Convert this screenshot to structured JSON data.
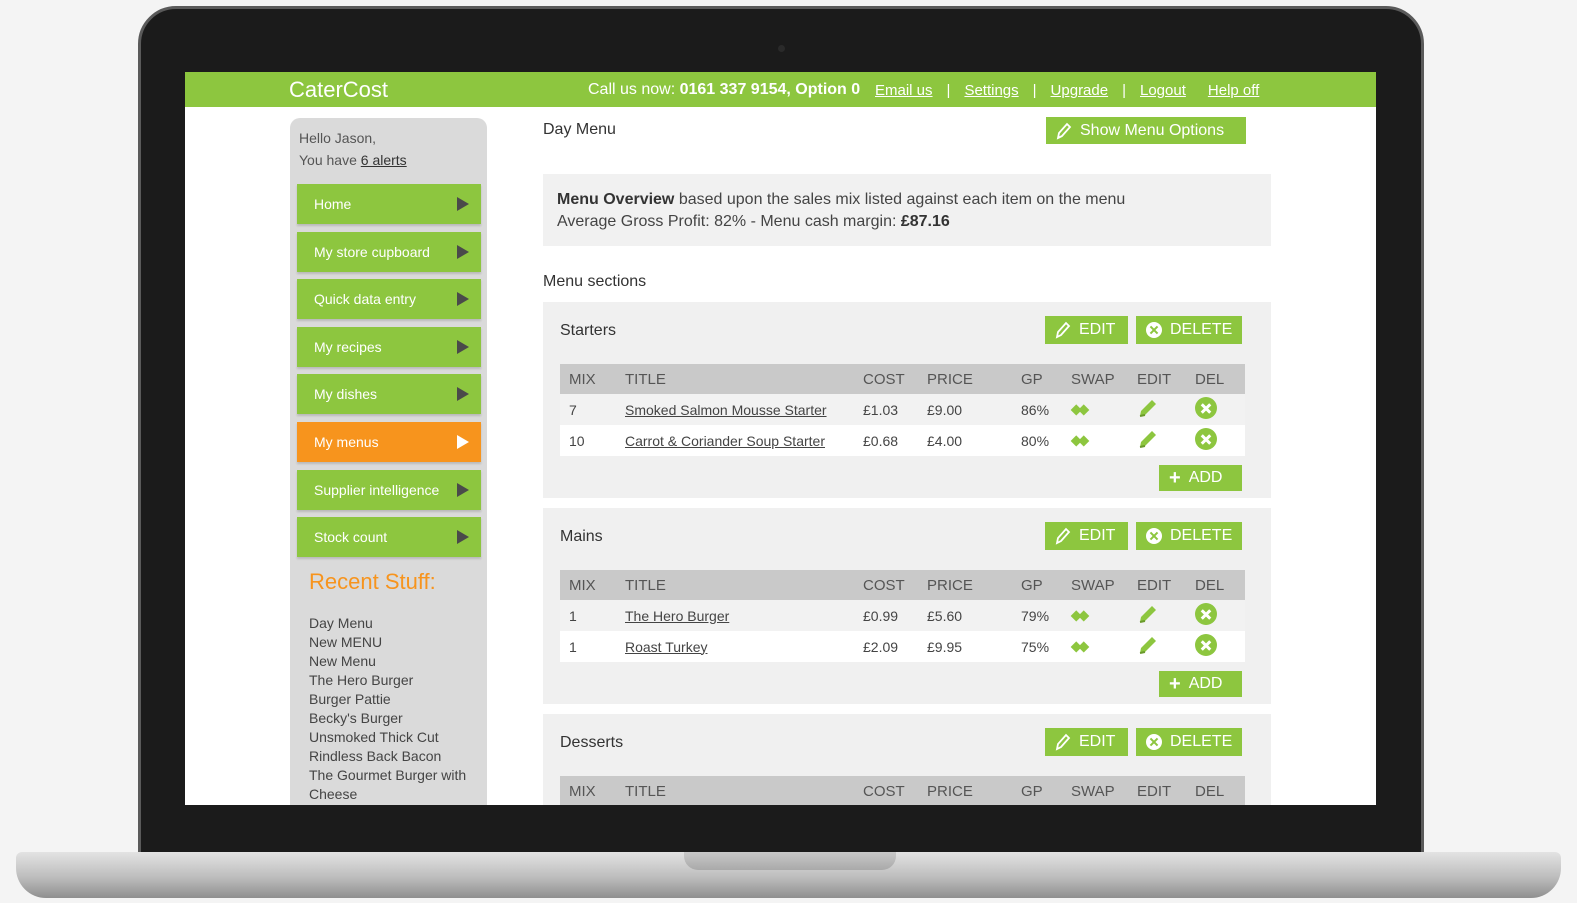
{
  "header": {
    "logo": "CaterCost",
    "call_prefix": "Call us now:",
    "phone": "0161 337 9154, Option 0",
    "links": [
      "Email us",
      "Settings",
      "Upgrade",
      "Logout",
      "Help off"
    ]
  },
  "sidebar": {
    "hello": "Hello Jason,",
    "alerts_prefix": "You have",
    "alerts_link": "6 alerts",
    "nav": [
      "Home",
      "My store cupboard",
      "Quick data entry",
      "My recipes",
      "My dishes",
      "My menus",
      "Supplier intelligence",
      "Stock count"
    ],
    "active_nav": "My menus",
    "recent_title": "Recent Stuff:",
    "recent": [
      "Day Menu",
      "New MENU",
      "New Menu",
      "The Hero Burger",
      "Burger Pattie",
      "Becky's Burger",
      "Unsmoked Thick Cut",
      "Rindless Back Bacon",
      "The Gourmet Burger with Cheese"
    ]
  },
  "main": {
    "title": "Day Menu",
    "show_options": "Show Menu Options",
    "overview_bold": "Menu Overview",
    "overview_rest": "based upon the sales mix listed against each item on the menu",
    "overview_line2": "Average Gross Profit: 82% - Menu cash margin:",
    "cash_margin": "£87.16",
    "sections_title": "Menu sections",
    "edit_label": "EDIT",
    "delete_label": "DELETE",
    "add_label": "ADD",
    "columns": [
      "MIX",
      "TITLE",
      "COST",
      "PRICE",
      "GP",
      "SWAP",
      "EDIT",
      "DEL"
    ],
    "sections": [
      {
        "name": "Starters",
        "rows": [
          {
            "mix": "7",
            "title": "Smoked Salmon Mousse Starter",
            "cost": "£1.03",
            "price": "£9.00",
            "gp": "86%"
          },
          {
            "mix": "10",
            "title": "Carrot & Coriander Soup Starter",
            "cost": "£0.68",
            "price": "£4.00",
            "gp": "80%"
          }
        ]
      },
      {
        "name": "Mains",
        "rows": [
          {
            "mix": "1",
            "title": "The Hero Burger",
            "cost": "£0.99",
            "price": "£5.60",
            "gp": "79%"
          },
          {
            "mix": "1",
            "title": "Roast Turkey",
            "cost": "£2.09",
            "price": "£9.95",
            "gp": "75%"
          }
        ]
      },
      {
        "name": "Desserts",
        "rows": []
      }
    ]
  },
  "colors": {
    "brand_green": "#8dc63f",
    "accent_orange": "#f7941d"
  }
}
